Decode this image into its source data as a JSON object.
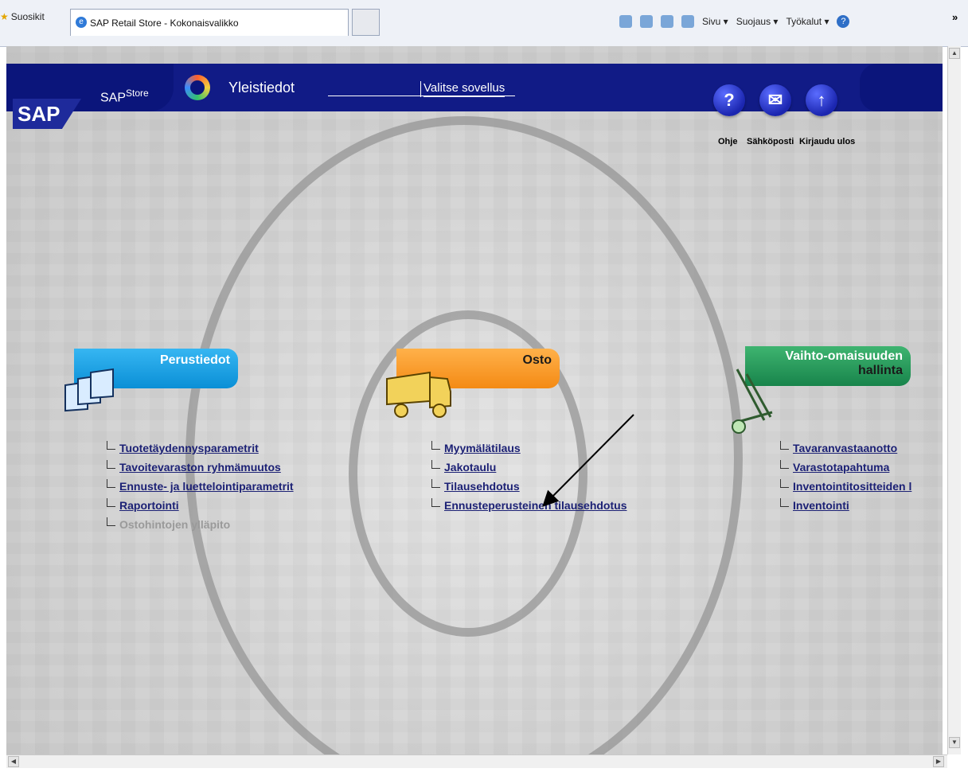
{
  "browser": {
    "favorites_label": "Suosikit",
    "tab_title": "SAP Retail Store - Kokonaisvalikko",
    "menu": [
      "Sivu ▾",
      "Suojaus ▾",
      "Työkalut ▾"
    ],
    "overflow": "»"
  },
  "header": {
    "sap_store": "SAP",
    "sap_store_sub": "Store",
    "app_title": "Yleistiedot",
    "select_app": "Valitse sovellus",
    "logo_text": "SAP",
    "buttons": [
      {
        "label": "Ohje",
        "icon": "question-icon",
        "glyph": "?"
      },
      {
        "label": "Sähköposti",
        "icon": "mail-icon",
        "glyph": "✉"
      },
      {
        "label": "Kirjaudu ulos",
        "icon": "up-arrow-icon",
        "glyph": "↑"
      }
    ]
  },
  "sections": {
    "left": {
      "title": "Perustiedot",
      "links": [
        {
          "label": "Tuotetäydennysparametrit",
          "enabled": true
        },
        {
          "label": "Tavoitevaraston ryhmämuutos",
          "enabled": true
        },
        {
          "label": "Ennuste- ja luettelointiparametrit",
          "enabled": true
        },
        {
          "label": "Raportointi",
          "enabled": true
        },
        {
          "label": "Ostohintojen ylläpito",
          "enabled": false
        }
      ]
    },
    "center": {
      "title": "Osto",
      "links": [
        {
          "label": "Myymälätilaus",
          "enabled": true
        },
        {
          "label": "Jakotaulu",
          "enabled": true
        },
        {
          "label": "Tilausehdotus",
          "enabled": true
        },
        {
          "label": "Ennusteperusteinen tilausehdotus",
          "enabled": true
        }
      ]
    },
    "right": {
      "title_line1": "Vaihto-omaisuuden",
      "title_line2": "hallinta",
      "links": [
        {
          "label": "Tavaranvastaanotto",
          "enabled": true
        },
        {
          "label": "Varastotapahtuma",
          "enabled": true
        },
        {
          "label": "Inventointitositteiden l",
          "enabled": true
        },
        {
          "label": "Inventointi",
          "enabled": true
        }
      ]
    }
  }
}
